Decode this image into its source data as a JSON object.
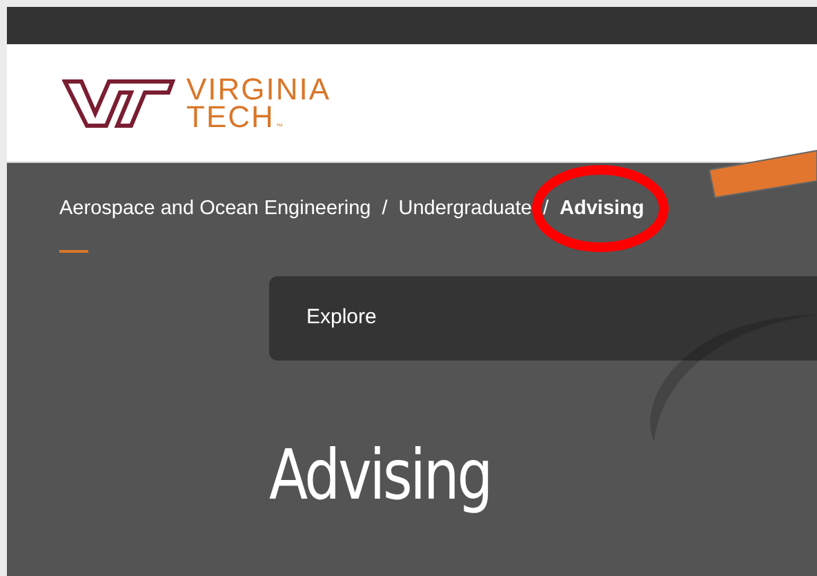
{
  "header": {
    "logo": {
      "line_1": "VIRGINIA",
      "line_2": "TECH",
      "mark": "™"
    }
  },
  "breadcrumb": [
    {
      "label": "Aerospace and Ocean Engineering",
      "current": false
    },
    {
      "label": "Undergraduate",
      "current": false
    },
    {
      "label": "Advising",
      "current": true
    }
  ],
  "breadcrumb_separator": "/",
  "explore": {
    "label": "Explore"
  },
  "heading": "Advising"
}
